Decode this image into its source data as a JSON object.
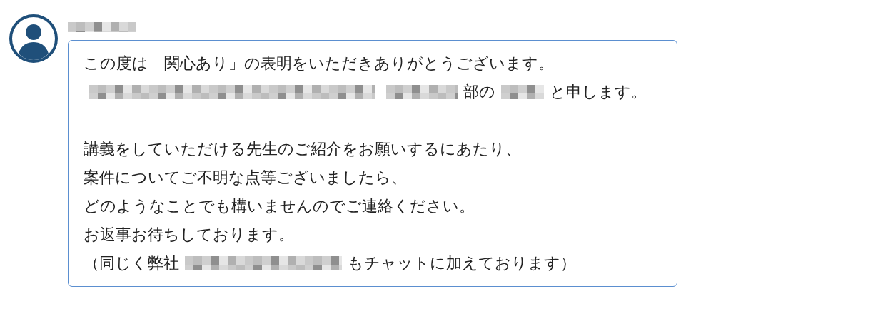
{
  "message": {
    "sender": {
      "kind": "redacted"
    },
    "lines": [
      [
        {
          "kind": "text",
          "text": "この度は「関心あり」の表明をいただきありがとうございます。"
        }
      ],
      [
        {
          "kind": "redacted"
        },
        {
          "kind": "redacted"
        },
        {
          "kind": "text",
          "text": "部の"
        },
        {
          "kind": "redacted"
        },
        {
          "kind": "text",
          "text": "と申します。"
        }
      ],
      [
        {
          "kind": "blank"
        }
      ],
      [
        {
          "kind": "text",
          "text": "講義をしていただける先生のご紹介をお願いするにあたり、"
        }
      ],
      [
        {
          "kind": "text",
          "text": "案件についてご不明な点等ございましたら、"
        }
      ],
      [
        {
          "kind": "text",
          "text": "どのようなことでも構いませんのでご連絡ください。"
        }
      ],
      [
        {
          "kind": "text",
          "text": "お返事お待ちしております。"
        }
      ],
      [
        {
          "kind": "text",
          "text": "（同じく弊社"
        },
        {
          "kind": "redacted"
        },
        {
          "kind": "text",
          "text": "もチャットに加えております）"
        }
      ]
    ]
  }
}
